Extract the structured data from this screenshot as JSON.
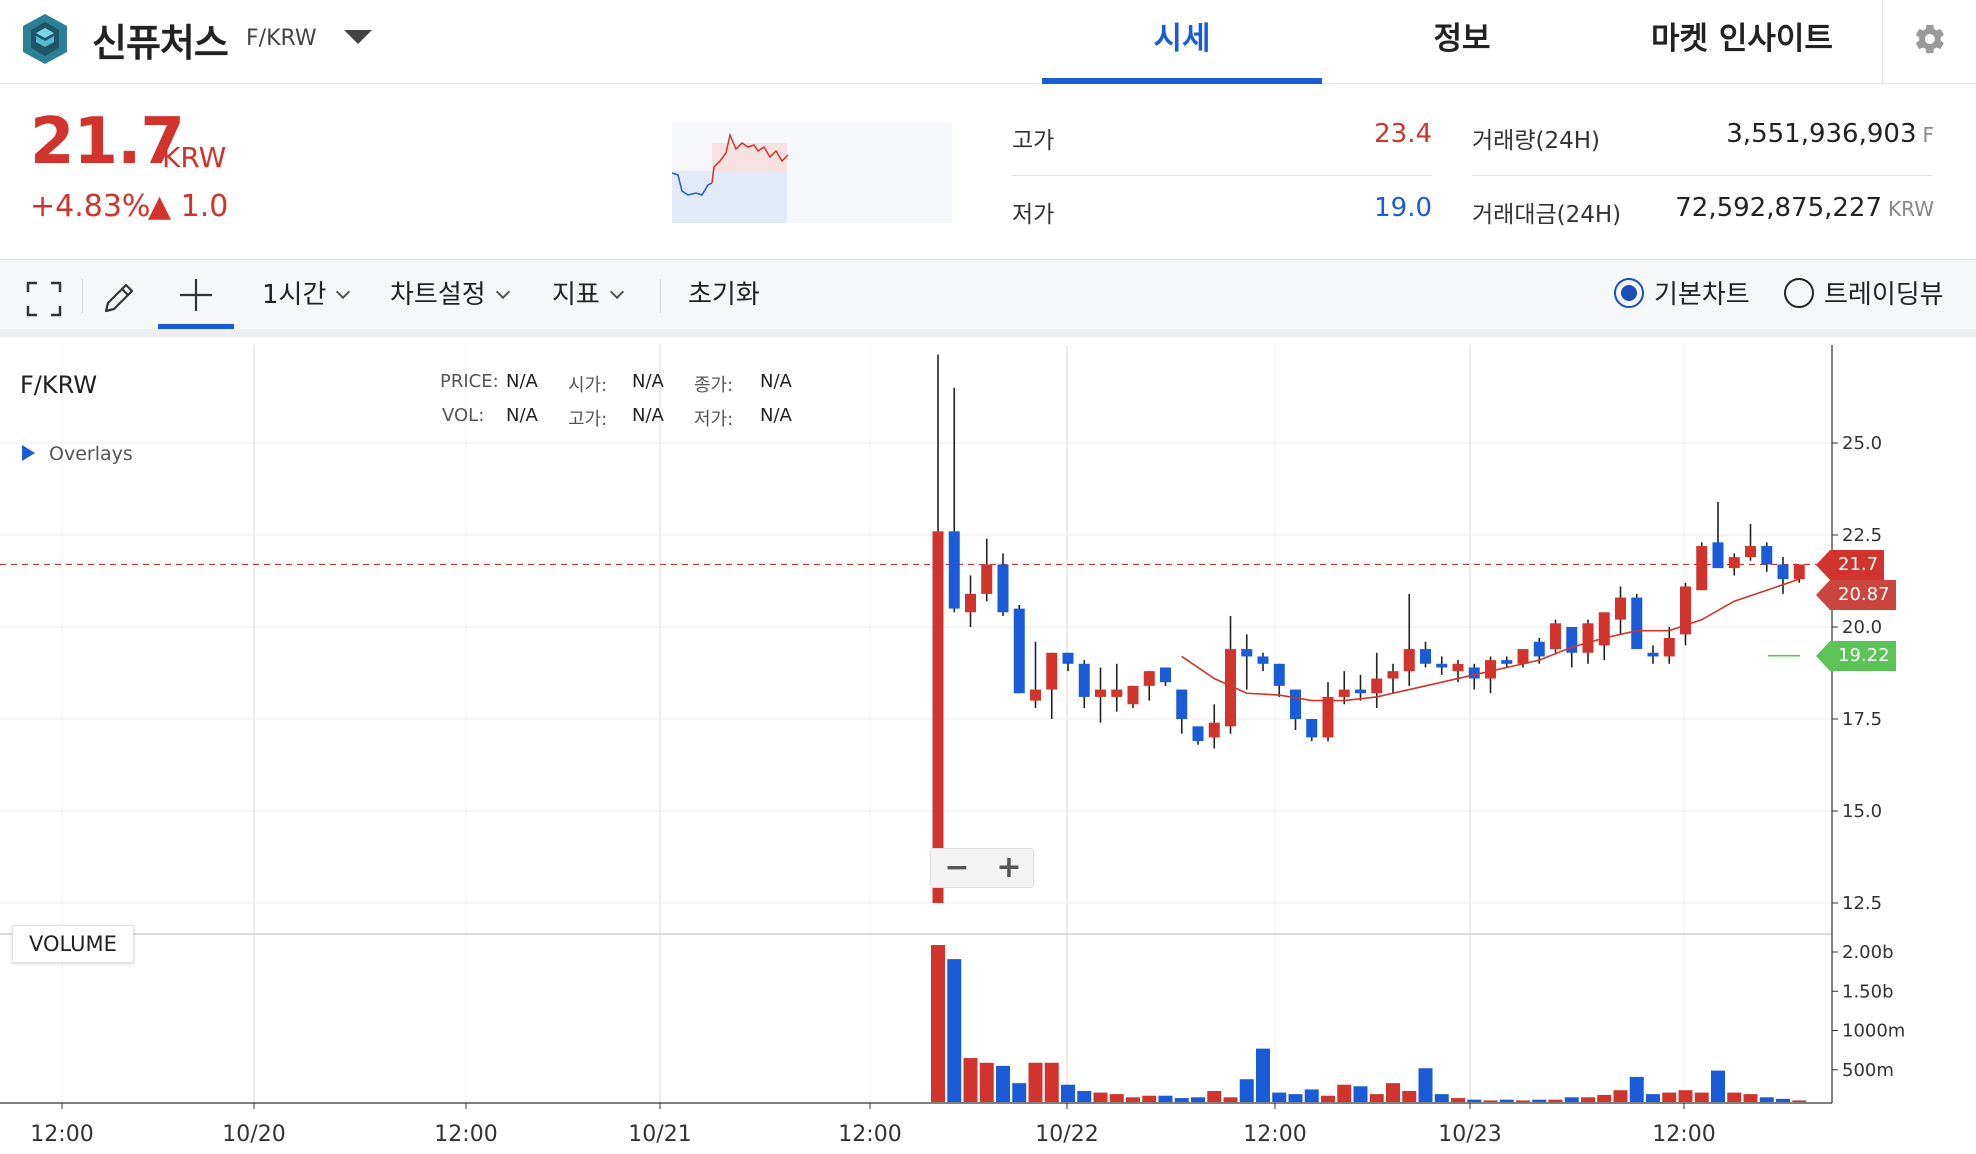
{
  "header": {
    "coin_name": "신퓨처스",
    "pair": "F/KRW",
    "tabs": [
      {
        "label": "시세",
        "active": true
      },
      {
        "label": "정보",
        "active": false
      },
      {
        "label": "마켓 인사이트",
        "active": false
      }
    ],
    "settings_icon": "gear-icon"
  },
  "summary": {
    "price": "21.7",
    "unit": "KRW",
    "change_rate": "+4.83%",
    "change_value": "▲ 1.0",
    "high_label": "고가",
    "high_value": "23.4",
    "low_label": "저가",
    "low_value": "19.0",
    "volume_label": "거래량(24H)",
    "volume_value": "3,551,936,903",
    "volume_unit": "F",
    "amount_label": "거래대금(24H)",
    "amount_value": "72,592,875,227",
    "amount_unit": "KRW"
  },
  "toolbar": {
    "fullscreen_icon": "fullscreen-icon",
    "draw_icon": "pencil-icon",
    "crosshair_icon": "crosshair-icon",
    "interval": "1시간",
    "chart_settings": "차트설정",
    "indicators": "지표",
    "reset": "초기화",
    "view_basic": "기본차트",
    "view_trading": "트레이딩뷰",
    "selected_view": "기본차트"
  },
  "chart": {
    "symbol": "F/KRW",
    "overlays": "Overlays",
    "ohlc_labels": {
      "price": "PRICE:",
      "open": "시가:",
      "close": "종가:",
      "vol": "VOL:",
      "high": "고가:",
      "low": "저가:"
    },
    "ohlc_values": {
      "price": "N/A",
      "open": "N/A",
      "close": "N/A",
      "vol": "N/A",
      "high": "N/A",
      "low": "N/A"
    },
    "volume_label": "VOLUME",
    "zoom_out": "−",
    "zoom_in": "+",
    "last_price_tag": "21.7",
    "ma_tag": "20.87",
    "other_tag": "19.22",
    "colors": {
      "up": "#d0342c",
      "down": "#1a5bd8",
      "ma": "#d0342c",
      "green": "#5cc456",
      "ma_tag": "#c9453e"
    }
  },
  "chart_data": {
    "type": "candlestick",
    "title": "F/KRW",
    "x_tick_labels": [
      "12:00",
      "10/20",
      "12:00",
      "10/21",
      "12:00",
      "10/22",
      "12:00",
      "10/23",
      "12:00"
    ],
    "y_tick_labels": [
      "25.0",
      "22.5",
      "20.0",
      "17.5",
      "15.0",
      "12.5"
    ],
    "ylim": [
      12.5,
      25.0
    ],
    "volume_tick_labels": [
      "2.00b",
      "1.50b",
      "1000m",
      "500m"
    ],
    "grid": true,
    "candles": [
      {
        "o": 12.5,
        "h": 27.4,
        "l": 12.5,
        "c": 22.6
      },
      {
        "o": 22.6,
        "h": 26.5,
        "l": 20.4,
        "c": 20.5
      },
      {
        "o": 20.4,
        "h": 21.4,
        "l": 20.0,
        "c": 20.9
      },
      {
        "o": 20.9,
        "h": 22.4,
        "l": 20.7,
        "c": 21.7
      },
      {
        "o": 21.7,
        "h": 22.0,
        "l": 20.3,
        "c": 20.4
      },
      {
        "o": 20.5,
        "h": 20.6,
        "l": 18.2,
        "c": 18.2
      },
      {
        "o": 18.0,
        "h": 19.6,
        "l": 17.8,
        "c": 18.3
      },
      {
        "o": 18.3,
        "h": 19.3,
        "l": 17.5,
        "c": 19.3
      },
      {
        "o": 19.3,
        "h": 19.3,
        "l": 18.8,
        "c": 19.0
      },
      {
        "o": 19.0,
        "h": 19.1,
        "l": 17.8,
        "c": 18.1
      },
      {
        "o": 18.1,
        "h": 18.9,
        "l": 17.4,
        "c": 18.3
      },
      {
        "o": 18.1,
        "h": 19.0,
        "l": 17.7,
        "c": 18.3
      },
      {
        "o": 17.9,
        "h": 18.4,
        "l": 17.8,
        "c": 18.4
      },
      {
        "o": 18.4,
        "h": 18.8,
        "l": 18.0,
        "c": 18.8
      },
      {
        "o": 18.9,
        "h": 18.9,
        "l": 18.4,
        "c": 18.5
      },
      {
        "o": 18.3,
        "h": 18.3,
        "l": 17.1,
        "c": 17.5
      },
      {
        "o": 17.3,
        "h": 17.3,
        "l": 16.8,
        "c": 16.9
      },
      {
        "o": 17.0,
        "h": 17.9,
        "l": 16.7,
        "c": 17.4
      },
      {
        "o": 17.3,
        "h": 20.3,
        "l": 17.1,
        "c": 19.4
      },
      {
        "o": 19.4,
        "h": 19.8,
        "l": 18.3,
        "c": 19.2
      },
      {
        "o": 19.2,
        "h": 19.3,
        "l": 18.8,
        "c": 19.0
      },
      {
        "o": 19.0,
        "h": 19.0,
        "l": 18.1,
        "c": 18.4
      },
      {
        "o": 18.3,
        "h": 18.3,
        "l": 17.2,
        "c": 17.5
      },
      {
        "o": 17.5,
        "h": 17.5,
        "l": 16.9,
        "c": 17.0
      },
      {
        "o": 17.0,
        "h": 18.5,
        "l": 16.9,
        "c": 18.1
      },
      {
        "o": 18.1,
        "h": 18.8,
        "l": 17.9,
        "c": 18.3
      },
      {
        "o": 18.3,
        "h": 18.7,
        "l": 18.0,
        "c": 18.2
      },
      {
        "o": 18.2,
        "h": 19.3,
        "l": 17.8,
        "c": 18.6
      },
      {
        "o": 18.6,
        "h": 19.0,
        "l": 18.2,
        "c": 18.8
      },
      {
        "o": 18.8,
        "h": 20.9,
        "l": 18.4,
        "c": 19.4
      },
      {
        "o": 19.4,
        "h": 19.6,
        "l": 18.9,
        "c": 19.0
      },
      {
        "o": 19.0,
        "h": 19.2,
        "l": 18.7,
        "c": 18.9
      },
      {
        "o": 18.8,
        "h": 19.1,
        "l": 18.5,
        "c": 19.0
      },
      {
        "o": 18.9,
        "h": 19.0,
        "l": 18.3,
        "c": 18.6
      },
      {
        "o": 18.6,
        "h": 19.2,
        "l": 18.2,
        "c": 19.1
      },
      {
        "o": 19.1,
        "h": 19.2,
        "l": 18.9,
        "c": 19.0
      },
      {
        "o": 19.0,
        "h": 19.3,
        "l": 18.9,
        "c": 19.4
      },
      {
        "o": 19.6,
        "h": 19.7,
        "l": 19.0,
        "c": 19.2
      },
      {
        "o": 19.4,
        "h": 20.2,
        "l": 19.3,
        "c": 20.1
      },
      {
        "o": 20.0,
        "h": 20.0,
        "l": 18.9,
        "c": 19.3
      },
      {
        "o": 19.3,
        "h": 20.2,
        "l": 19.0,
        "c": 20.1
      },
      {
        "o": 19.5,
        "h": 20.3,
        "l": 19.1,
        "c": 20.4
      },
      {
        "o": 20.2,
        "h": 21.1,
        "l": 19.8,
        "c": 20.8
      },
      {
        "o": 20.8,
        "h": 20.9,
        "l": 19.9,
        "c": 19.4
      },
      {
        "o": 19.3,
        "h": 19.5,
        "l": 19.0,
        "c": 19.2
      },
      {
        "o": 19.2,
        "h": 20.0,
        "l": 19.0,
        "c": 19.7
      },
      {
        "o": 19.8,
        "h": 21.2,
        "l": 19.5,
        "c": 21.1
      },
      {
        "o": 21.0,
        "h": 22.3,
        "l": 21.0,
        "c": 22.2
      },
      {
        "o": 22.3,
        "h": 23.4,
        "l": 21.9,
        "c": 21.6
      },
      {
        "o": 21.6,
        "h": 22.0,
        "l": 21.4,
        "c": 21.9
      },
      {
        "o": 21.9,
        "h": 22.8,
        "l": 21.8,
        "c": 22.2
      },
      {
        "o": 22.2,
        "h": 22.3,
        "l": 21.5,
        "c": 21.7
      },
      {
        "o": 21.7,
        "h": 21.9,
        "l": 20.9,
        "c": 21.3
      },
      {
        "o": 21.3,
        "h": 21.7,
        "l": 21.2,
        "c": 21.7
      }
    ],
    "volume": [
      2.0,
      1.82,
      0.56,
      0.5,
      0.46,
      0.24,
      0.5,
      0.5,
      0.22,
      0.14,
      0.12,
      0.1,
      0.06,
      0.08,
      0.08,
      0.05,
      0.06,
      0.14,
      0.06,
      0.29,
      0.68,
      0.12,
      0.1,
      0.16,
      0.08,
      0.22,
      0.2,
      0.1,
      0.24,
      0.14,
      0.43,
      0.1,
      0.05,
      0.03,
      0.02,
      0.03,
      0.02,
      0.03,
      0.03,
      0.06,
      0.06,
      0.09,
      0.15,
      0.32,
      0.1,
      0.12,
      0.15,
      0.12,
      0.4,
      0.12,
      0.1,
      0.06,
      0.04,
      0.02
    ],
    "moving_average": [
      {
        "i": 15,
        "v": 19.2
      },
      {
        "i": 17,
        "v": 18.6
      },
      {
        "i": 19,
        "v": 18.2
      },
      {
        "i": 21,
        "v": 18.15
      },
      {
        "i": 23,
        "v": 18.0
      },
      {
        "i": 25,
        "v": 18.0
      },
      {
        "i": 27,
        "v": 18.1
      },
      {
        "i": 29,
        "v": 18.3
      },
      {
        "i": 31,
        "v": 18.5
      },
      {
        "i": 33,
        "v": 18.7
      },
      {
        "i": 35,
        "v": 18.9
      },
      {
        "i": 37,
        "v": 19.1
      },
      {
        "i": 39,
        "v": 19.45
      },
      {
        "i": 41,
        "v": 19.7
      },
      {
        "i": 43,
        "v": 19.9
      },
      {
        "i": 45,
        "v": 19.9
      },
      {
        "i": 47,
        "v": 20.2
      },
      {
        "i": 49,
        "v": 20.7
      },
      {
        "i": 51,
        "v": 21.0
      },
      {
        "i": 53,
        "v": 21.3
      }
    ],
    "last_price_line": 21.7
  }
}
